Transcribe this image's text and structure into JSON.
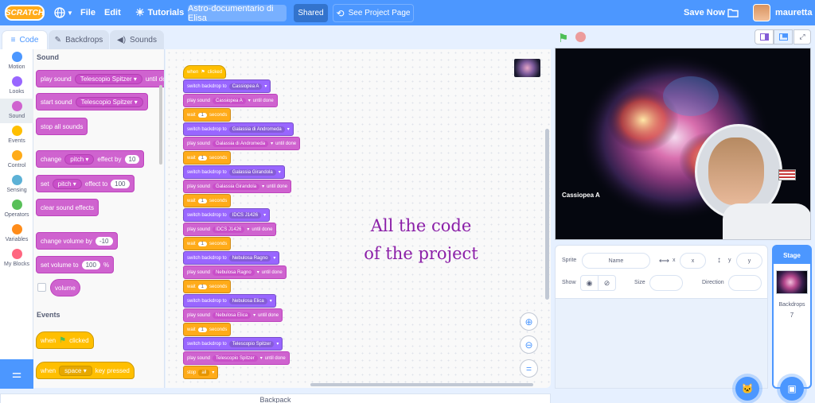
{
  "menubar": {
    "logo": "SCRATCH",
    "file": "File",
    "edit": "Edit",
    "tutorials": "Tutorials",
    "project_title": "Astro-documentario di Elisa",
    "shared": "Shared",
    "see_project_page": "See Project Page",
    "save_now": "Save Now",
    "username": "mauretta"
  },
  "tabs": {
    "code": "Code",
    "backdrops": "Backdrops",
    "sounds": "Sounds"
  },
  "categories": [
    "Motion",
    "Looks",
    "Sound",
    "Events",
    "Control",
    "Sensing",
    "Operators",
    "Variables",
    "My Blocks"
  ],
  "category_colors": [
    "#4c97ff",
    "#9966ff",
    "#cf63cf",
    "#ffbf00",
    "#ffab19",
    "#5cb1d6",
    "#59c059",
    "#ff8c1a",
    "#ff6680"
  ],
  "palette": {
    "sound_heading": "Sound",
    "play_sound": "play sound",
    "play_sound_dd": "Telescopio Spitzer",
    "until_done": "until done",
    "start_sound": "start sound",
    "start_sound_dd": "Telescopio Spitzer",
    "stop_all_sounds": "stop all sounds",
    "change": "change",
    "pitch": "pitch",
    "effect_by": "effect by",
    "change_value": "10",
    "set": "set",
    "effect_to": "effect to",
    "set_value": "100",
    "clear_sound_effects": "clear sound effects",
    "change_volume_by": "change volume by",
    "change_volume_value": "-10",
    "set_volume_to": "set volume to",
    "set_volume_value": "100",
    "percent": "%",
    "volume": "volume",
    "events_heading": "Events",
    "when": "when",
    "clicked": "clicked",
    "space": "space",
    "key_pressed": "key pressed"
  },
  "script": {
    "hat_when": "when",
    "hat_clicked": "clicked",
    "switch_backdrop_to": "switch backdrop to",
    "play_sound": "play sound",
    "until_done": "until done",
    "wait": "wait",
    "seconds": "seconds",
    "wait_value": "1",
    "stop": "stop",
    "stop_dd": "all",
    "targets": [
      "Cassiopea A",
      "Galassia di Andromeda",
      "Galassia Girandola",
      "IDCS J1426",
      "Nebulosa Ragno",
      "Nebulosa Elica",
      "Telescopio Spitzer"
    ]
  },
  "annotation": {
    "line1": "All the code",
    "line2": "of the project"
  },
  "stage": {
    "caption_title": "Cassiopea A"
  },
  "sprite_info": {
    "sprite_label": "Sprite",
    "sprite_name_placeholder": "Name",
    "x_label": "x",
    "x_placeholder": "x",
    "y_label": "y",
    "y_placeholder": "y",
    "show_label": "Show",
    "size_label": "Size",
    "direction_label": "Direction"
  },
  "stage_panel": {
    "title": "Stage",
    "backdrops_label": "Backdrops",
    "backdrops_count": "7"
  },
  "backpack": "Backpack"
}
